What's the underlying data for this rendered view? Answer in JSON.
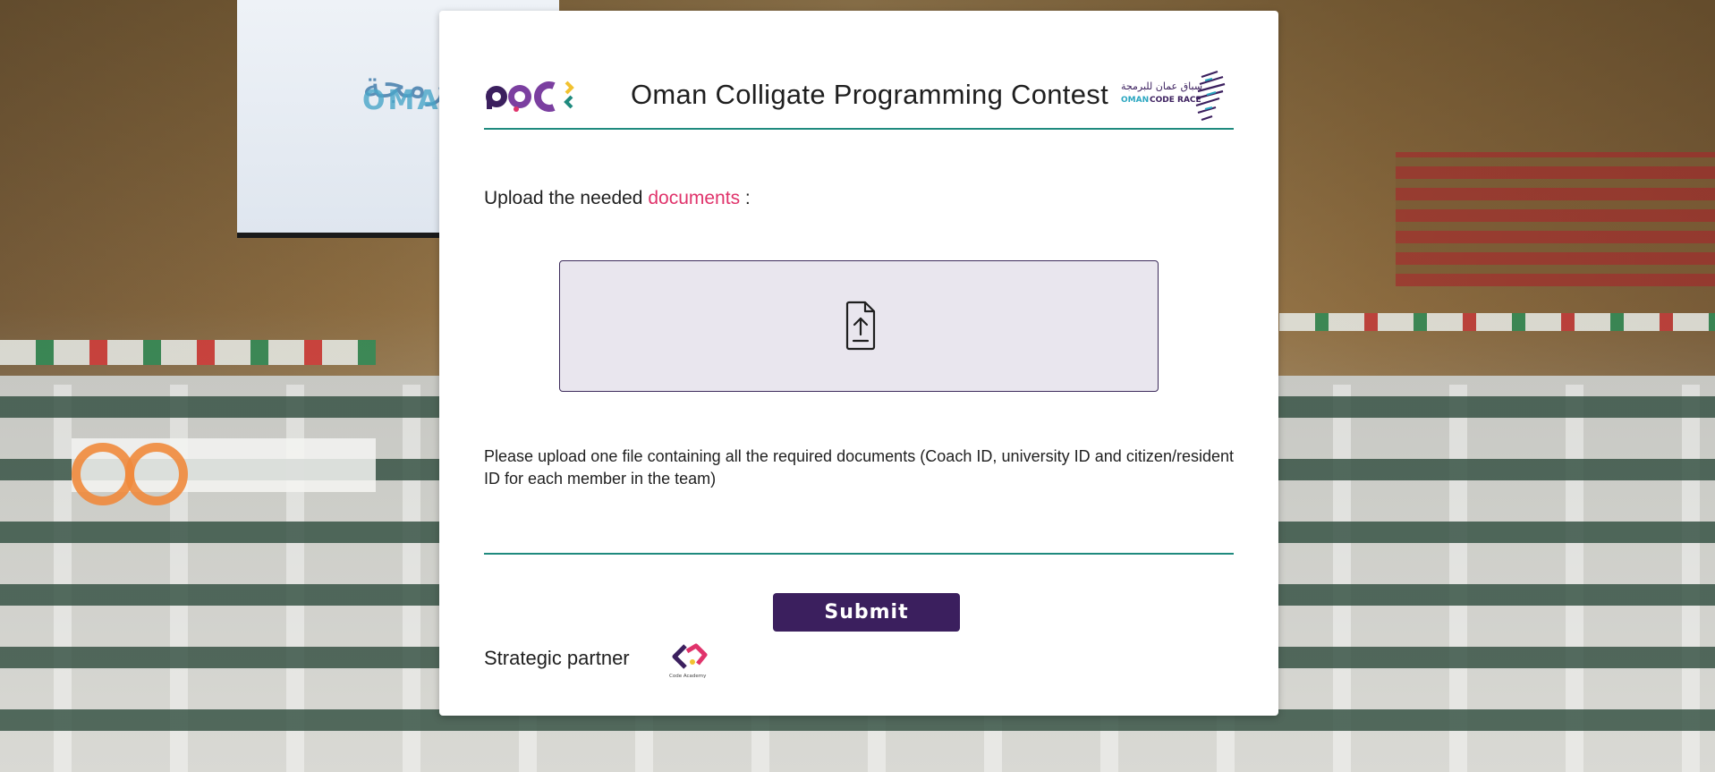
{
  "header": {
    "title": "Oman Colligate Programming Contest",
    "left_logo_text": "ocpc",
    "right_logo_text": "OMAN CODE RACE",
    "right_logo_arabic": "سباق عمان للبرمجة"
  },
  "upload": {
    "heading_prefix": "Upload the needed",
    "heading_accent": "documents",
    "heading_suffix": ":",
    "dropzone_icon": "file-upload-icon",
    "instructions": "Please upload one file containing all the required documents (Coach ID, university ID and citizen/resident ID for each member in the team)"
  },
  "actions": {
    "submit_label": "Submit"
  },
  "footer": {
    "partner_label": "Strategic partner",
    "partner_logo_text": "Code Academy"
  },
  "colors": {
    "accent": "#e0336b",
    "primary": "#3b1f5e",
    "rule": "#1f8a7e",
    "dropzone_bg": "#e9e6ee"
  }
}
